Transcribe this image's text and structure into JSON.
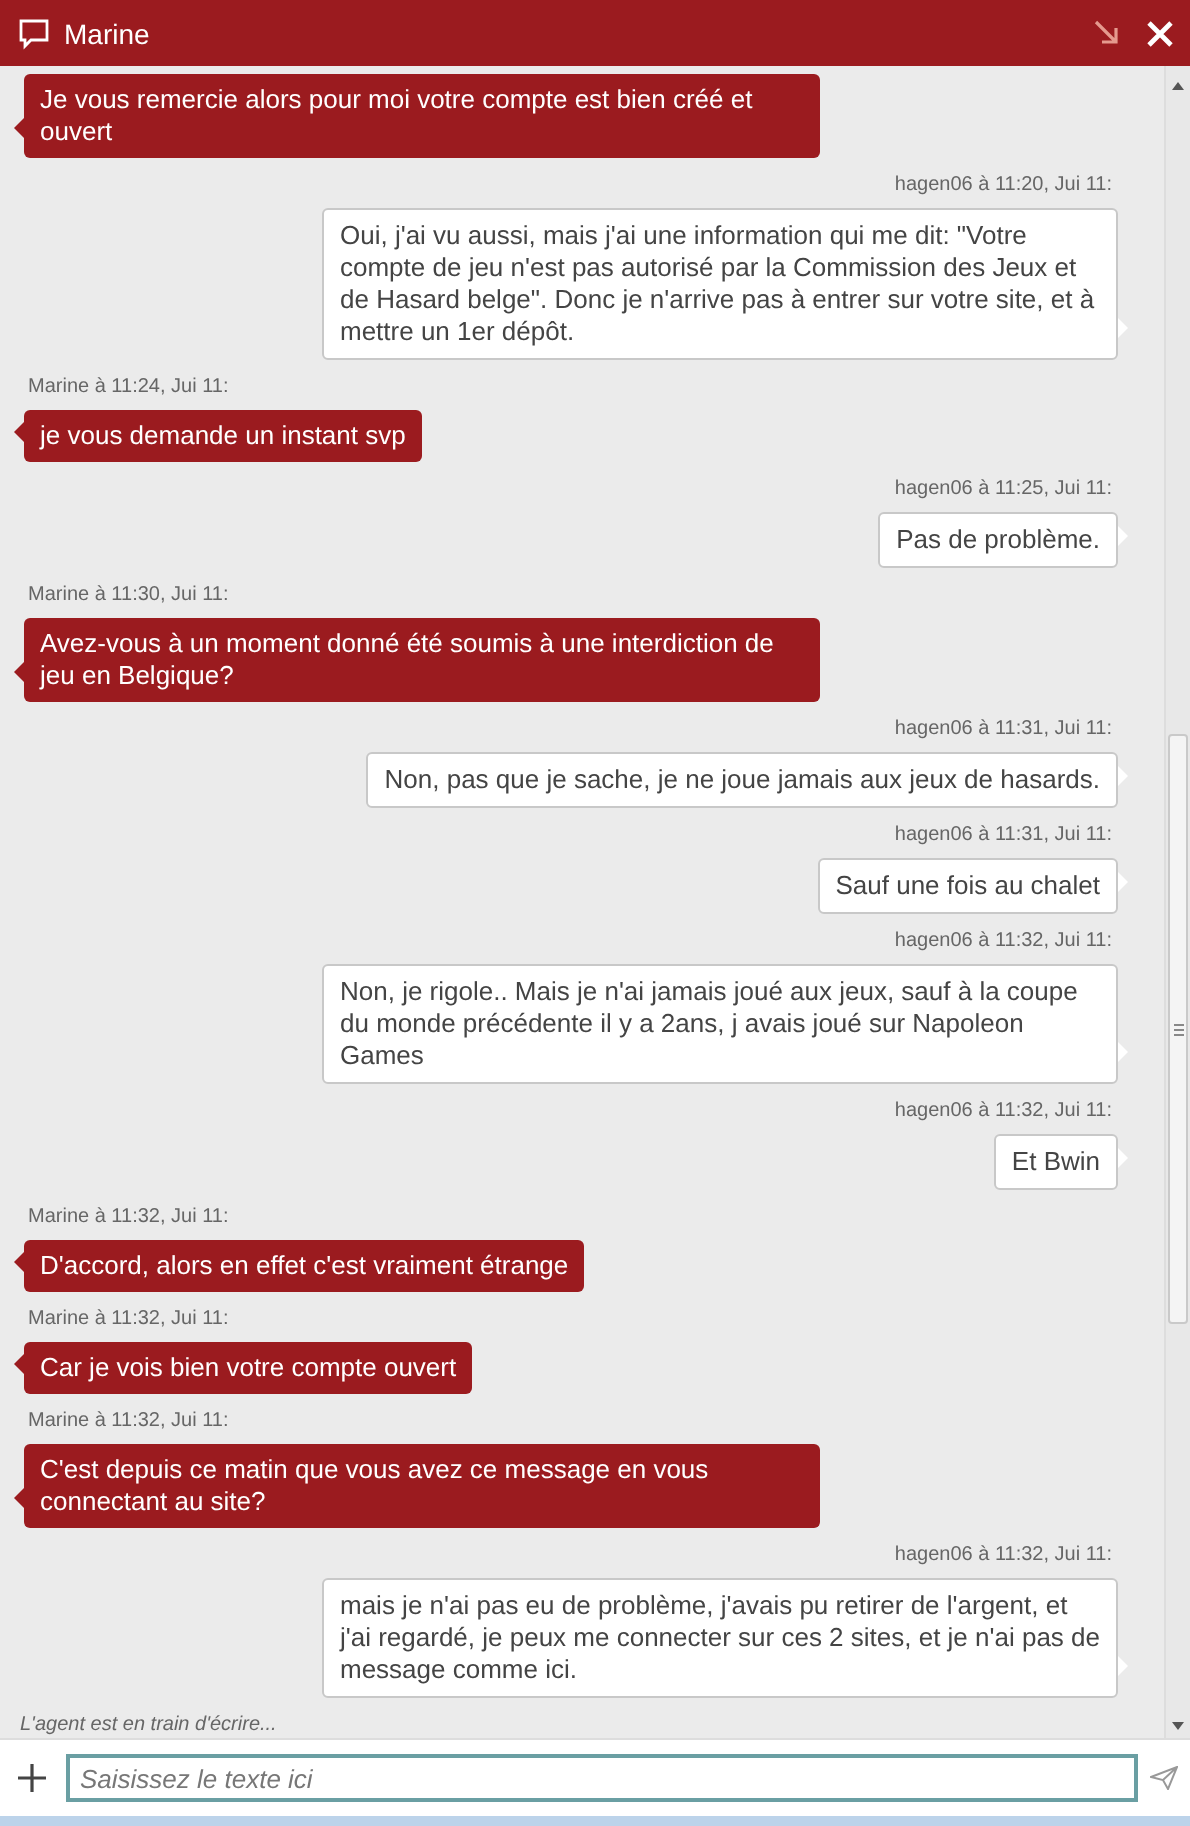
{
  "window": {
    "title": "Marine"
  },
  "messages": [
    {
      "kind": "agent",
      "text": "Je vous remercie alors pour moi votre compte est bien créé et ouvert"
    },
    {
      "kind": "user",
      "meta": "hagen06 à 11:20, Jui 11:",
      "text": "Oui, j'ai vu aussi, mais j'ai une information qui me dit: \"Votre compte de jeu n'est pas autorisé par la Commission des Jeux et de Hasard belge\". Donc je n'arrive pas à entrer sur votre site, et à mettre un 1er dépôt."
    },
    {
      "kind": "agent",
      "meta": "Marine à 11:24, Jui 11:",
      "text": "je vous demande un instant svp"
    },
    {
      "kind": "user",
      "meta": "hagen06 à 11:25, Jui 11:",
      "text": "Pas de problème."
    },
    {
      "kind": "agent",
      "meta": "Marine à 11:30, Jui 11:",
      "text": "Avez-vous à un moment donné été soumis à une interdiction de jeu en Belgique?"
    },
    {
      "kind": "user",
      "meta": "hagen06 à 11:31, Jui 11:",
      "text": "Non, pas que je sache, je ne joue jamais aux jeux de hasards."
    },
    {
      "kind": "user",
      "meta": "hagen06 à 11:31, Jui 11:",
      "text": "Sauf une fois au chalet"
    },
    {
      "kind": "user",
      "meta": "hagen06 à 11:32, Jui 11:",
      "text": "Non, je rigole.. Mais je n'ai jamais joué aux jeux, sauf à la coupe du monde précédente il y a 2ans, j avais joué sur Napoleon Games"
    },
    {
      "kind": "user",
      "meta": "hagen06 à 11:32, Jui 11:",
      "text": "Et Bwin"
    },
    {
      "kind": "agent",
      "meta": "Marine à 11:32, Jui 11:",
      "text": "D'accord, alors en effet c'est vraiment étrange"
    },
    {
      "kind": "agent",
      "meta": "Marine à 11:32, Jui 11:",
      "text": "Car je vois bien votre compte ouvert"
    },
    {
      "kind": "agent",
      "meta": "Marine à 11:32, Jui 11:",
      "text": "C'est depuis ce matin que vous avez ce message en vous connectant au site?"
    },
    {
      "kind": "user",
      "meta": "hagen06 à 11:32, Jui 11:",
      "text": "mais je n'ai pas eu de problème, j'avais pu retirer de l'argent, et j'ai regardé, je peux me connecter sur ces 2 sites, et je n'ai pas de message comme ici."
    }
  ],
  "typing_status": "L'agent est en train d'écrire...",
  "composer": {
    "placeholder": "Saisissez le texte ici"
  }
}
